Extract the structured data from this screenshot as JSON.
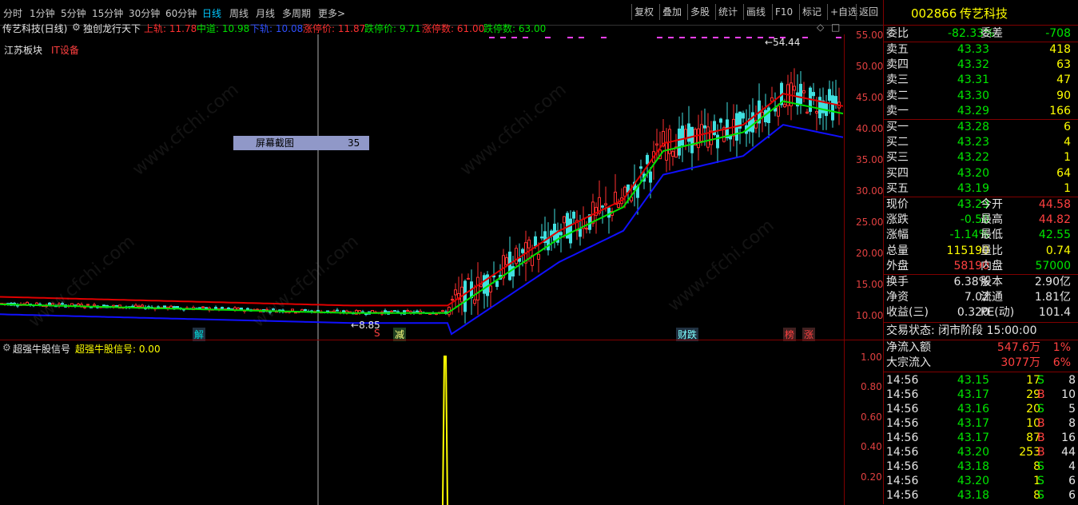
{
  "toolbar": {
    "periods": [
      "分时",
      "1分钟",
      "5分钟",
      "15分钟",
      "30分钟",
      "60分钟",
      "日线",
      "周线",
      "月线",
      "多周期",
      "更多>"
    ],
    "active_period": "日线",
    "right_buttons": [
      "复权",
      "叠加",
      "多股",
      "统计",
      "画线",
      "F10",
      "标记",
      "+自选",
      "返回"
    ]
  },
  "title": {
    "stock": "传艺科技(日线)",
    "indicator": "独创龙行天下",
    "upper": "上轨: 11.78",
    "middle": "中道: 10.98",
    "lower": "下轨: 10.08",
    "limit_up_price": "涨停价: 11.87",
    "limit_down_price": "跌停价: 9.71",
    "limit_up_count": "涨停数: 61.00",
    "limit_down_count": "跌停数: 63.00"
  },
  "tags": {
    "region": "江苏板块",
    "industry": "IT设备"
  },
  "price_axis": [
    "55.00",
    "50.00",
    "45.00",
    "40.00",
    "35.00",
    "30.00",
    "25.00",
    "20.00",
    "15.00",
    "10.00"
  ],
  "annotations": {
    "high": "54.44",
    "low": "8.85"
  },
  "markers": [
    "解",
    "S",
    "减",
    "财跌",
    "榜",
    "涨"
  ],
  "screenshot_tip": {
    "label": "屏幕截图",
    "value": "35"
  },
  "indicator_panel": {
    "title": "超强牛股信号",
    "value_text": "超强牛股信号: 0.00",
    "axis": [
      "1.00",
      "0.80",
      "0.60",
      "0.40",
      "0.20"
    ]
  },
  "quote": {
    "code": "002866",
    "name": "传艺科技",
    "weibi_label": "委比",
    "weibi": "-82.33%",
    "weicha_label": "委差",
    "weicha": "-708",
    "asks": [
      {
        "label": "卖五",
        "price": "43.33",
        "vol": "418"
      },
      {
        "label": "卖四",
        "price": "43.32",
        "vol": "63"
      },
      {
        "label": "卖三",
        "price": "43.31",
        "vol": "47"
      },
      {
        "label": "卖二",
        "price": "43.30",
        "vol": "90"
      },
      {
        "label": "卖一",
        "price": "43.29",
        "vol": "166"
      }
    ],
    "bids": [
      {
        "label": "买一",
        "price": "43.28",
        "vol": "6"
      },
      {
        "label": "买二",
        "price": "43.23",
        "vol": "4"
      },
      {
        "label": "买三",
        "price": "43.22",
        "vol": "1"
      },
      {
        "label": "买四",
        "price": "43.20",
        "vol": "64"
      },
      {
        "label": "买五",
        "price": "43.19",
        "vol": "1"
      }
    ],
    "stats": [
      {
        "l1": "现价",
        "v1": "43.29",
        "l2": "今开",
        "v2": "44.58"
      },
      {
        "l1": "涨跌",
        "v1": "-0.50",
        "l2": "最高",
        "v2": "44.82"
      },
      {
        "l1": "涨幅",
        "v1": "-1.14%",
        "l2": "最低",
        "v2": "42.55"
      },
      {
        "l1": "总量",
        "v1": "115190",
        "l2": "量比",
        "v2": "0.74"
      },
      {
        "l1": "外盘",
        "v1": "58190",
        "l2": "内盘",
        "v2": "57000"
      }
    ],
    "stats2": [
      {
        "l1": "换手",
        "v1": "6.38%",
        "l2": "股本",
        "v2": "2.90亿"
      },
      {
        "l1": "净资",
        "v1": "7.02",
        "l2": "流通",
        "v2": "1.81亿"
      },
      {
        "l1": "收益(三)",
        "v1": "0.320",
        "l2": "PE(动)",
        "v2": "101.4"
      }
    ],
    "trade_status": "交易状态: 闭市阶段 15:00:00",
    "flows": [
      {
        "label": "净流入额",
        "value": "547.6万",
        "pct": "1%"
      },
      {
        "label": "大宗流入",
        "value": "3077万",
        "pct": "6%"
      }
    ],
    "ticks": [
      {
        "t": "14:56",
        "p": "43.15",
        "v": "17",
        "s": "S",
        "n": "8"
      },
      {
        "t": "14:56",
        "p": "43.17",
        "v": "29",
        "s": "B",
        "n": "10"
      },
      {
        "t": "14:56",
        "p": "43.16",
        "v": "20",
        "s": "S",
        "n": "5"
      },
      {
        "t": "14:56",
        "p": "43.17",
        "v": "10",
        "s": "B",
        "n": "8"
      },
      {
        "t": "14:56",
        "p": "43.17",
        "v": "87",
        "s": "B",
        "n": "16"
      },
      {
        "t": "14:56",
        "p": "43.20",
        "v": "253",
        "s": "B",
        "n": "44"
      },
      {
        "t": "14:56",
        "p": "43.18",
        "v": "8",
        "s": "S",
        "n": "4"
      },
      {
        "t": "14:56",
        "p": "43.20",
        "v": "1",
        "s": "S",
        "n": "6"
      },
      {
        "t": "14:56",
        "p": "43.18",
        "v": "8",
        "s": "S",
        "n": "6"
      }
    ]
  },
  "colors": {
    "up": "#ff4040",
    "down": "#00e600",
    "upper_band": "#e00000",
    "middle_band": "#00e000",
    "lower_band": "#0000ff",
    "signal": "#ffff00"
  }
}
